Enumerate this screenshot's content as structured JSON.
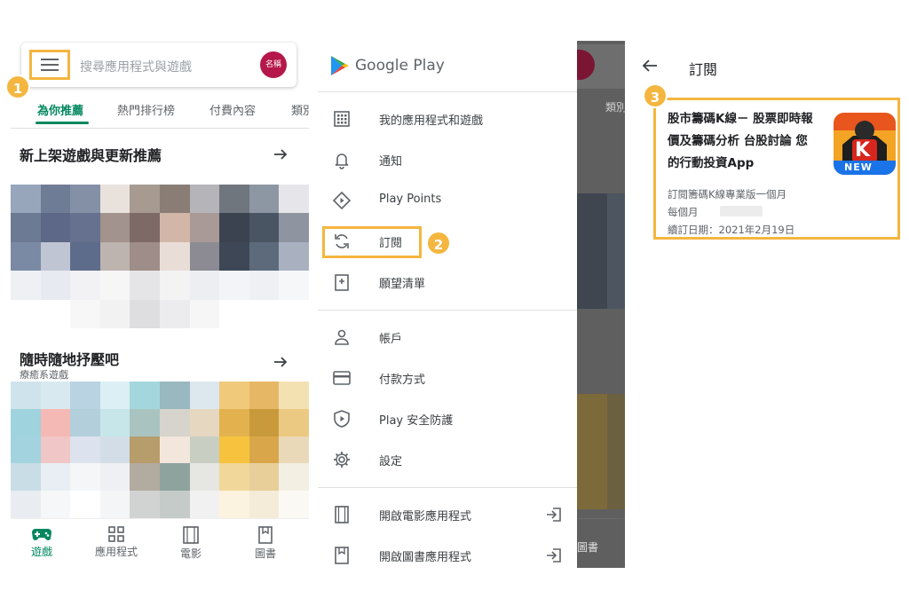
{
  "badges": [
    "1",
    "2",
    "3"
  ],
  "colors": {
    "accent_green": "#01875f",
    "highlight_yellow": "#f4b63f",
    "avatar_crimson": "#b5174b"
  },
  "home": {
    "search": {
      "placeholder": "搜尋應用程式與遊戲",
      "avatar_label": "名稱"
    },
    "tabs": [
      "為你推薦",
      "熱門排行榜",
      "付費內容",
      "類別"
    ],
    "sections": [
      {
        "title": "新上架遊戲與更新推薦",
        "subtitle": ""
      },
      {
        "title": "隨時隨地抒壓吧",
        "subtitle": "療癒系遊戲"
      }
    ],
    "bottom_nav": [
      {
        "label": "遊戲",
        "icon": "gamepad-icon",
        "active": true
      },
      {
        "label": "應用程式",
        "icon": "apps-grid-icon",
        "active": false
      },
      {
        "label": "電影",
        "icon": "film-icon",
        "active": false
      },
      {
        "label": "圖書",
        "icon": "book-icon",
        "active": false
      }
    ]
  },
  "drawer": {
    "brand": "Google Play",
    "items": [
      {
        "label": "我的應用程式和遊戲",
        "icon": "apps-icon"
      },
      {
        "label": "通知",
        "icon": "bell-icon"
      },
      {
        "label": "Play Points",
        "icon": "play-points-icon"
      },
      {
        "label": "訂閱",
        "icon": "refresh-icon"
      },
      {
        "label": "願望清單",
        "icon": "bookmark-icon"
      },
      {
        "label": "帳戶",
        "icon": "person-icon"
      },
      {
        "label": "付款方式",
        "icon": "credit-card-icon"
      },
      {
        "label": "Play 安全防護",
        "icon": "shield-play-icon"
      },
      {
        "label": "設定",
        "icon": "gear-icon"
      },
      {
        "label": "開啟電影應用程式",
        "icon": "film-icon"
      },
      {
        "label": "開啟圖書應用程式",
        "icon": "book-icon"
      }
    ],
    "behind_tab": "類別",
    "behind_nav": "圖書"
  },
  "subscriptions": {
    "title": "訂閱",
    "card": {
      "app_name": "股市籌碼K線－ 股票即時報價及籌碼分析 台股討論 您的行動投資App",
      "icon_letter": "K",
      "icon_badge": "NEW",
      "plan": "訂閱籌碼K線專業版一個月",
      "period": "每個月",
      "renewal": "續訂日期：2021年2月19日"
    }
  }
}
